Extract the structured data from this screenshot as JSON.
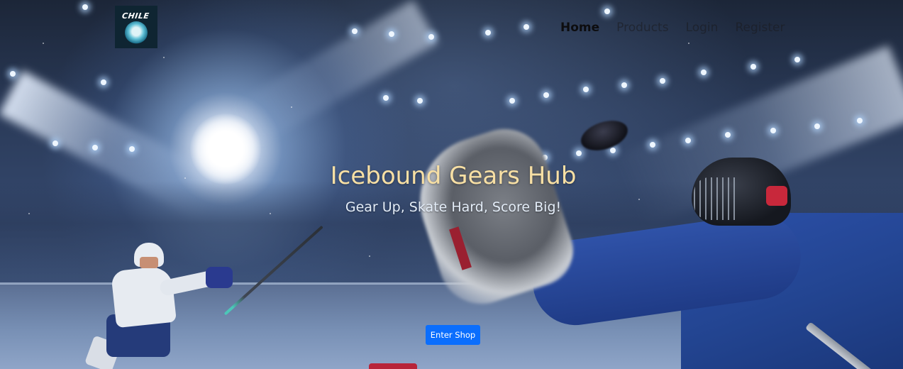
{
  "brand": {
    "logo_text": "CHILE",
    "logo_icon": "hockey-mascot-logo-icon"
  },
  "nav": {
    "items": [
      {
        "label": "Home",
        "active": true
      },
      {
        "label": "Products",
        "active": false
      },
      {
        "label": "Login",
        "active": false
      },
      {
        "label": "Register",
        "active": false
      }
    ]
  },
  "hero": {
    "title": "Icebound Gears Hub",
    "subtitle": "Gear Up, Skate Hard, Score Big!",
    "cta_label": "Enter Shop",
    "background_scene": "ice-hockey-arena-photo"
  },
  "colors": {
    "title": "#f7dfa4",
    "subtitle": "#e4edf8",
    "button": "#0b6efd",
    "nav_active": "#0d0d0f",
    "nav_inactive": "#5a5b60",
    "logo_bg": "#0f2532"
  }
}
